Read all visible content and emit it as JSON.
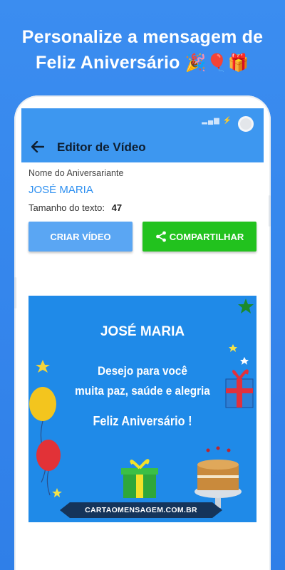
{
  "headline": {
    "line1": "Personalize a mensagem de",
    "line2": "Feliz Aniversário",
    "emojis": "🎉🎈🎁"
  },
  "appbar": {
    "title": "Editor de Vídeo",
    "back_icon": "arrow-left-icon"
  },
  "form": {
    "name_label": "Nome do Aniversariante",
    "name_value": "JOSÉ MARIA",
    "size_label": "Tamanho do texto:",
    "size_value": "47"
  },
  "buttons": {
    "create_label": "CRIAR VÍDEO",
    "share_label": "COMPARTILHAR",
    "share_icon": "share-icon"
  },
  "card": {
    "name": "JOSÉ MARIA",
    "wish_line1": "Desejo para você",
    "wish_line2": "muita paz, saúde e alegria",
    "greeting": "Feliz Aniversário !",
    "site": "CARTAOMENSAGEM.COM.BR"
  },
  "colors": {
    "background": "#3b8df0",
    "appbar": "#3d97f0",
    "accent_text": "#2d8ff0",
    "create_button": "#5aa6f3",
    "share_button": "#22c21e",
    "card_background": "#1f8ae8"
  }
}
